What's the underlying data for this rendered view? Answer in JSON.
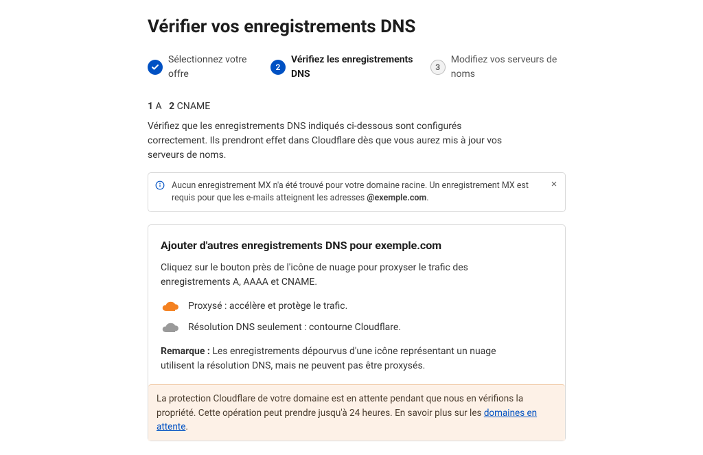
{
  "title": "Vérifier vos enregistrements DNS",
  "stepper": {
    "step1": {
      "label": "Sélectionnez votre offre"
    },
    "step2": {
      "num": "2",
      "label": "Vérifiez les enregistrements DNS"
    },
    "step3": {
      "num": "3",
      "label": "Modifiez vos serveurs de noms"
    }
  },
  "counts": {
    "a_num": "1",
    "a_label": "A",
    "cname_num": "2",
    "cname_label": "CNAME"
  },
  "intro": "Vérifiez que les enregistrements DNS indiqués ci-dessous sont configurés correctement. Ils prendront effet dans Cloudflare dès que vous aurez mis à jour vos serveurs de noms.",
  "alert": {
    "text_before": "Aucun enregistrement MX n'a été trouvé pour votre domaine racine. Un enregistrement MX est requis pour que les e-mails atteignent les adresses ",
    "domain": "@exemple.com",
    "text_after": "."
  },
  "card": {
    "heading": "Ajouter d'autres enregistrements DNS pour exemple.com",
    "lead": "Cliquez sur le bouton près de l'icône de nuage pour proxyser le trafic des enregistrements A, AAAA et CNAME.",
    "proxied": "Proxysé : accélère et protège le trafic.",
    "dns_only": "Résolution DNS seulement : contourne Cloudflare.",
    "note_label": "Remarque :",
    "note_text": " Les enregistrements dépourvus d'une icône représentant un nuage utilisent la résolution DNS, mais ne peuvent pas être proxysés."
  },
  "pending": {
    "text_before": "La protection Cloudflare de votre domaine est en attente pendant que nous en vérifions la propriété. Cette opération peut prendre jusqu'à 24 heures. En savoir plus sur les ",
    "link": "domaines en attente",
    "text_after": "."
  }
}
